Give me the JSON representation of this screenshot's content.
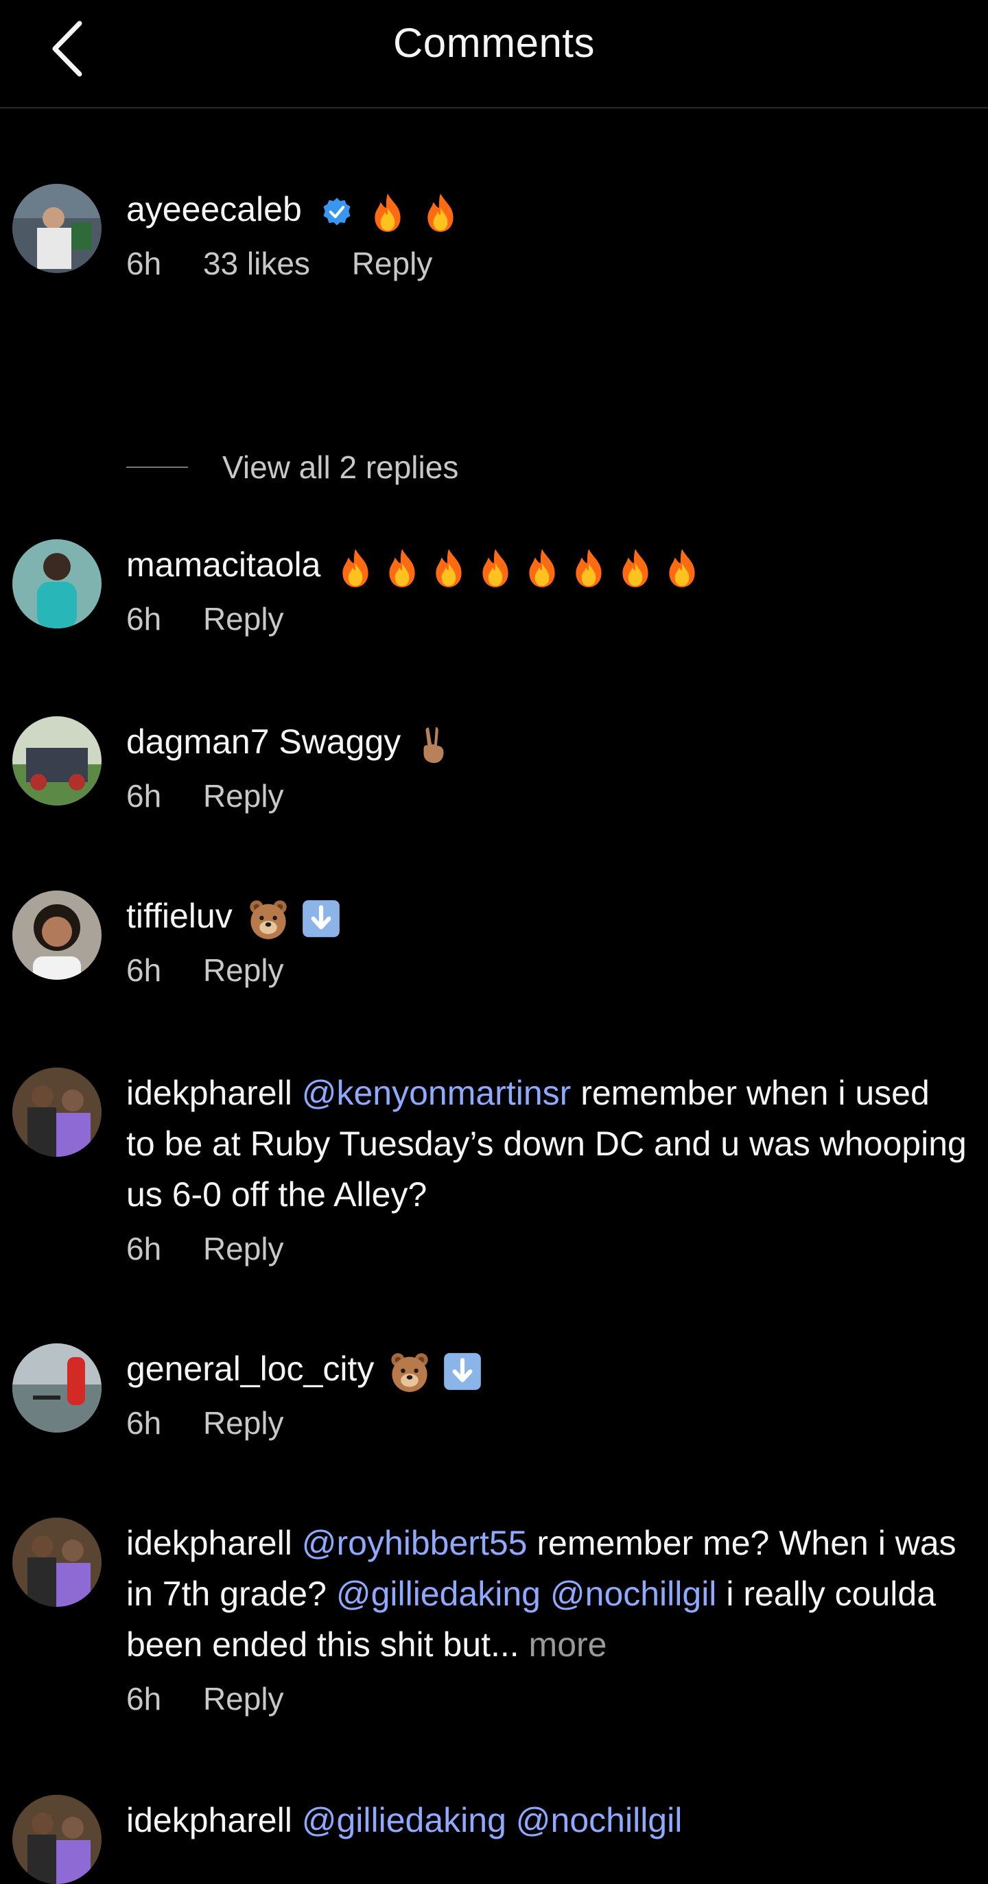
{
  "header": {
    "title": "Comments",
    "back_icon": "chevron-left-icon"
  },
  "comments": [
    {
      "username": "ayeeecaleb",
      "verified": true,
      "text": "",
      "emojis": [
        "fire",
        "fire"
      ],
      "time": "6h",
      "likes": "33 likes",
      "reply": "Reply"
    },
    {
      "username": "mamacitaola",
      "text": "",
      "emojis": [
        "fire",
        "fire",
        "fire",
        "fire",
        "fire",
        "fire",
        "fire",
        "fire"
      ],
      "time": "6h",
      "reply": "Reply"
    },
    {
      "username": "dagman7",
      "text": "Swaggy",
      "emojis": [
        "victory-hand"
      ],
      "time": "6h",
      "reply": "Reply"
    },
    {
      "username": "tiffieluv",
      "text": "",
      "emojis": [
        "bear-face",
        "down-arrow"
      ],
      "time": "6h",
      "reply": "Reply"
    },
    {
      "username": "idekpharell",
      "mention1": "@kenyonmartinsr",
      "text": "remember when i used to be at Ruby Tuesday’s down DC and u was whooping us 6-0 off the Alley?",
      "time": "6h",
      "reply": "Reply"
    },
    {
      "username": "general_loc_city",
      "text": "",
      "emojis": [
        "bear-face",
        "down-arrow"
      ],
      "time": "6h",
      "reply": "Reply"
    },
    {
      "username": "idekpharell",
      "mention1": "@royhibbert55",
      "text_a": "remember me? When i was in 7th grade?",
      "mention2": "@gilliedaking",
      "mention3": "@nochillgil",
      "text_b": "i really coulda been ended this shit but...",
      "more": "more",
      "time": "6h",
      "reply": "Reply"
    },
    {
      "username": "idekpharell",
      "mention1": "@gilliedaking",
      "mention2": "@nochillgil"
    }
  ],
  "view_replies": "View all 2 replies",
  "colors": {
    "background": "#000000",
    "mention": "#8fa9ff",
    "verified": "#3897f0",
    "muted": "#c8c8c8"
  }
}
